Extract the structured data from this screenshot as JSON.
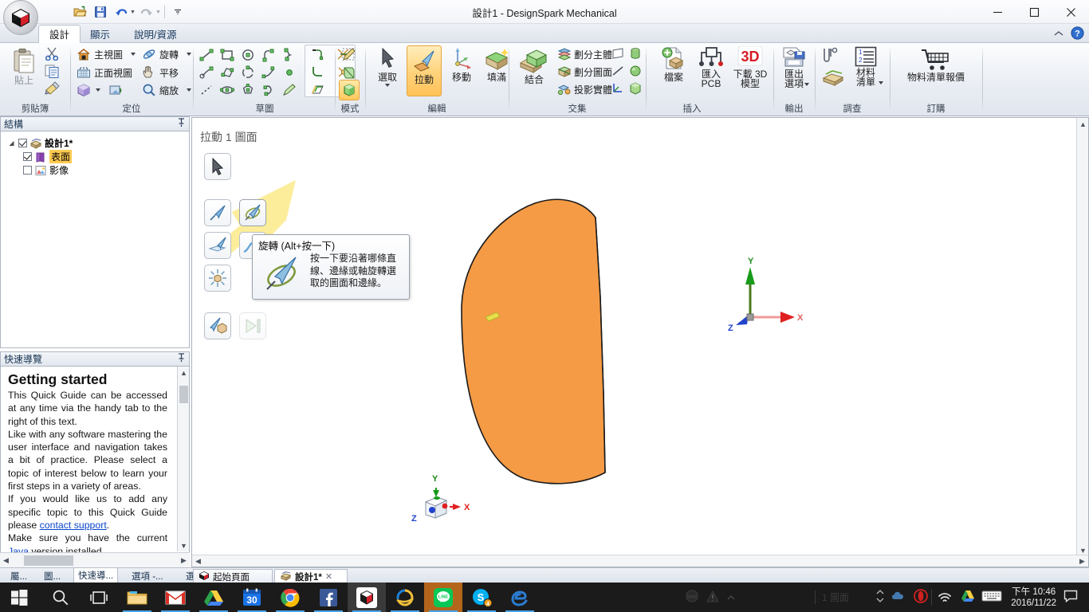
{
  "window": {
    "title": "設計1 - DesignSpark Mechanical",
    "app_icon": "designspark-cube-icon",
    "minimize": "minimize-icon",
    "maximize": "maximize-icon",
    "close": "close-icon"
  },
  "quick_access": [
    {
      "name": "open-icon",
      "label": "開啟"
    },
    {
      "name": "save-icon",
      "label": "儲存"
    },
    {
      "name": "undo-icon",
      "label": "復原"
    },
    {
      "name": "redo-icon",
      "label": "重做"
    },
    {
      "name": "customize-icon",
      "label": "自訂快速存取工具列"
    }
  ],
  "ribbon_tabs": [
    {
      "label": "設計",
      "active": true
    },
    {
      "label": "顯示",
      "active": false
    },
    {
      "label": "說明/資源",
      "active": false
    }
  ],
  "ribbon_right": [
    {
      "name": "collapse-ribbon-icon"
    },
    {
      "name": "help-icon"
    }
  ],
  "ribbon_groups": [
    {
      "id": "clipboard",
      "label": "剪貼簿",
      "big": {
        "label": "貼上",
        "icon": "paste-icon",
        "disabled": true
      },
      "small": [
        {
          "label": "",
          "icon": "cut-icon"
        },
        {
          "label": "",
          "icon": "copy-icon"
        },
        {
          "label": "",
          "icon": "format-painter-icon"
        }
      ]
    },
    {
      "id": "orient",
      "label": "定位",
      "items": [
        {
          "label": "主視圖",
          "icon": "home-view-icon",
          "caret": true
        },
        {
          "label": "旋轉",
          "icon": "spin-icon",
          "caret": true
        },
        {
          "label": "正面視圖",
          "icon": "plan-view-icon",
          "caret": false
        },
        {
          "label": "平移",
          "icon": "pan-icon",
          "caret": false
        },
        {
          "label": "",
          "icon": "view-cube-icon",
          "caret": true
        },
        {
          "label": "",
          "icon": "previous-view-icon",
          "caret": false
        },
        {
          "label": "縮放",
          "icon": "zoom-icon",
          "caret": true
        }
      ]
    },
    {
      "id": "sketch",
      "label": "草圖",
      "tools": [
        "line-icon",
        "rectangle-icon",
        "circle-icon",
        "tangent-arc-icon",
        "spline-icon",
        "polyline-icon",
        "three-point-rectangle-icon",
        "three-point-arc-icon",
        "curve-icon",
        "point-icon",
        "construction-line-icon",
        "ellipse-icon",
        "polygon-icon",
        "sweep-arc-icon",
        "edit-sketch-icon"
      ],
      "modify": [
        "trim-away-icon",
        "split-icon",
        "corner-icon",
        "trim-icon",
        "offset-icon",
        "project-icon"
      ]
    },
    {
      "id": "mode",
      "label": "模式",
      "items": [
        {
          "icon": "sketch-mode-icon",
          "selected": false
        },
        {
          "icon": "section-mode-icon",
          "selected": false
        },
        {
          "icon": "solid-mode-icon",
          "selected": true
        }
      ]
    },
    {
      "id": "edit",
      "label": "編輯",
      "items": [
        {
          "label": "選取",
          "icon": "select-icon",
          "caret": true,
          "selected": false
        },
        {
          "label": "拉動",
          "icon": "pull-icon",
          "caret": false,
          "selected": true
        },
        {
          "label": "移動",
          "icon": "move-icon",
          "caret": false,
          "selected": false
        },
        {
          "label": "填滿",
          "icon": "fill-icon",
          "caret": false,
          "selected": false
        }
      ]
    },
    {
      "id": "intersect",
      "label": "交集",
      "big": {
        "label": "結合",
        "icon": "combine-icon"
      },
      "small": [
        {
          "label": "劃分主體",
          "icon": "split-body-icon"
        },
        {
          "label": "劃分圖面",
          "icon": "split-face-icon"
        },
        {
          "label": "投影實體",
          "icon": "project-solid-icon"
        }
      ]
    },
    {
      "id": "insert",
      "label": "插入",
      "mini": [
        "plane-icon",
        "cylinder-icon",
        "line-axis-icon",
        "sphere-icon",
        "origin-icon",
        "component-icon"
      ],
      "items": [
        {
          "label": "檔案",
          "icon": "insert-file-icon"
        },
        {
          "label": "匯入\nPCB",
          "icon": "import-pcb-icon"
        },
        {
          "label": "下載 3D\n模型",
          "icon": "download-3d-icon"
        }
      ]
    },
    {
      "id": "output",
      "label": "輸出",
      "items": [
        {
          "label": "匯出\n選項",
          "icon": "export-icon",
          "caret": true
        }
      ]
    },
    {
      "id": "survey",
      "label": "調查",
      "items": [
        {
          "label": "",
          "icon": "measure-icon"
        },
        {
          "label": "材料\n清單",
          "icon": "bom-icon",
          "caret": true
        },
        {
          "label": "",
          "icon": "material-icon"
        }
      ]
    },
    {
      "id": "order",
      "label": "訂購",
      "items": [
        {
          "label": "物料清單報價",
          "icon": "cart-icon"
        }
      ]
    }
  ],
  "structure_panel": {
    "title": "結構",
    "pin": "pin-icon",
    "nodes": [
      {
        "label": "設計1*",
        "icon": "design-icon",
        "checked": true,
        "bold": true,
        "indent": 0,
        "expander": true,
        "highlight": false
      },
      {
        "label": "表面",
        "icon": "surface-icon",
        "checked": true,
        "bold": false,
        "indent": 1,
        "expander": false,
        "highlight": true
      },
      {
        "label": "影像",
        "icon": "image-icon",
        "checked": false,
        "bold": false,
        "indent": 1,
        "expander": false,
        "highlight": false
      }
    ]
  },
  "quick_guide": {
    "title": "快速導覽",
    "pin": "pin-icon",
    "heading": "Getting started",
    "paragraphs": [
      "This Quick Guide can be accessed at any time via the handy tab to the right of this text.",
      "Like with any software mastering the user interface and navigation takes a bit of practice. Please select a topic of interest below to learn your first steps in a variety of areas."
    ],
    "p3_before": "If you would like us to add any specific topic to this Quick Guide please ",
    "p3_link": "contact support",
    "p3_after": ".",
    "p4_before": "Make sure you have the current ",
    "p4_link": "Java",
    "p4_after": " version installed."
  },
  "viewport": {
    "header": "拉動 1 圖面",
    "shape_color": "#F59B45",
    "shape_outline": "#1a1a1a",
    "axis_labels": {
      "x": "X",
      "y": "Y",
      "z": "Z"
    },
    "axis_colors": {
      "x": "#e02020",
      "y": "#1a8a1a",
      "z": "#2244cc"
    }
  },
  "palette": {
    "cursor_button": "select-cursor-icon",
    "buttons": [
      {
        "name": "pull-direction-icon",
        "state": "normal"
      },
      {
        "name": "revolve-icon",
        "state": "hover"
      },
      {
        "name": "pull-both-sides-icon",
        "state": "normal"
      },
      {
        "name": "sweep-icon",
        "state": "normal"
      },
      {
        "name": "scale-body-icon",
        "state": "normal"
      },
      {
        "name": "pull-to-point-icon",
        "state": "normal"
      },
      {
        "name": "next-step-icon",
        "state": "disabled"
      }
    ]
  },
  "tooltip": {
    "title": "旋轉 (Alt+按一下)",
    "icon": "revolve-icon",
    "description": "按一下要沿著哪條直線、邊緣或軸旋轉選取的圖面和邊緣。"
  },
  "bottom_tabs": [
    {
      "label": "屬...",
      "active": false
    },
    {
      "label": "圖...",
      "active": false
    },
    {
      "label": "快速導...",
      "active": true
    },
    {
      "label": "選項 -...",
      "active": false
    },
    {
      "label": "選取項...",
      "active": false
    }
  ],
  "document_tabs": [
    {
      "label": "起始頁面",
      "icon": "home-page-icon",
      "active": false,
      "closable": false
    },
    {
      "label": "設計1*",
      "icon": "design-doc-icon",
      "active": true,
      "closable": true
    }
  ],
  "status_bar": {
    "text": "1 圖面",
    "icons": [
      "stop-icon",
      "warning-icon",
      "expand-icon"
    ],
    "nav_left": "nav-prev-icon",
    "nav_right": "nav-next-icon"
  },
  "taskbar": {
    "start": "windows-start-icon",
    "search": "search-icon",
    "taskview": "task-view-icon",
    "apps": [
      {
        "name": "file-explorer-icon",
        "running": true,
        "active": false
      },
      {
        "name": "gmail-icon",
        "running": true,
        "active": false
      },
      {
        "name": "google-drive-icon",
        "running": true,
        "active": false
      },
      {
        "name": "calendar-icon",
        "running": true,
        "active": false,
        "badge": "30"
      },
      {
        "name": "chrome-icon",
        "running": true,
        "active": false
      },
      {
        "name": "facebook-icon",
        "running": true,
        "active": false
      },
      {
        "name": "designspark-icon",
        "running": true,
        "active": true
      },
      {
        "name": "internet-explorer-icon",
        "running": true,
        "active": false
      },
      {
        "name": "line-icon",
        "running": true,
        "active": false,
        "highlight": "#b4651c"
      },
      {
        "name": "skype-icon",
        "running": true,
        "active": false,
        "badge": "4"
      },
      {
        "name": "edge-icon",
        "running": true,
        "active": false
      }
    ],
    "tray": [
      "show-hidden-icons-icon",
      "onedrive-icon",
      "opera-icon",
      "wifi-icon",
      "drive-sync-icon",
      "keyboard-icon",
      "volume-icon",
      "action-center-icon"
    ],
    "clock_time": "下午 10:46",
    "clock_date": "2016/11/22"
  }
}
